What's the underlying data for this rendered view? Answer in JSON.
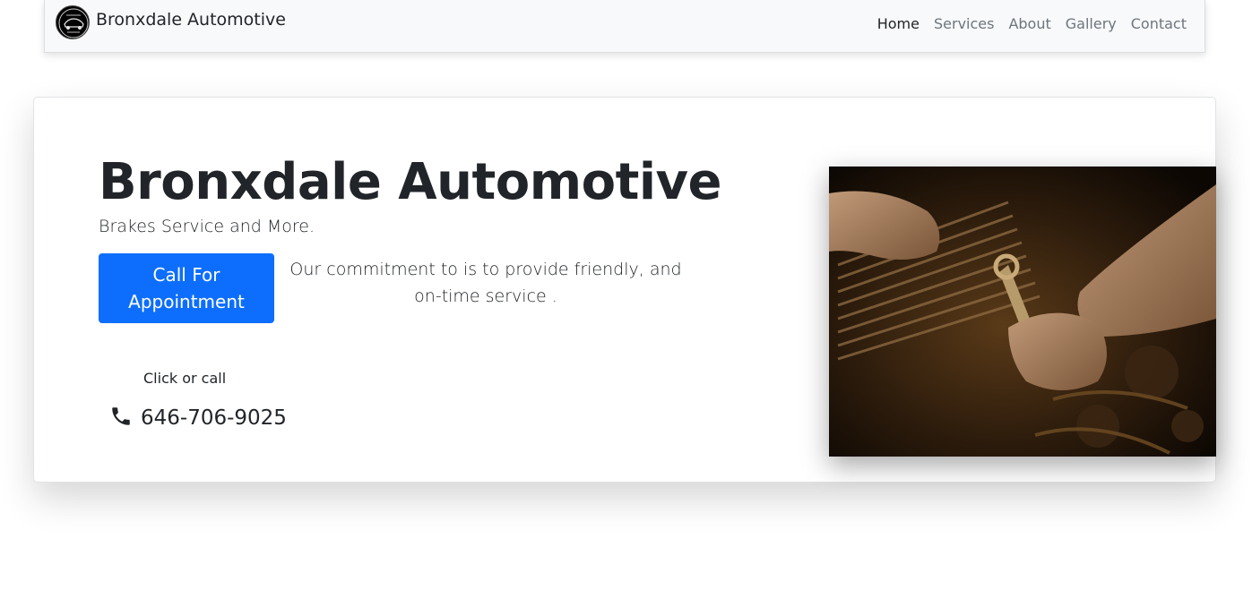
{
  "navbar": {
    "brand": "Bronxdale Automotive",
    "links": [
      "Home",
      "Services",
      "About",
      "Gallery",
      "Contact"
    ]
  },
  "hero": {
    "title": "Bronxdale Automotive",
    "subtitle": "Brakes Service and More.",
    "cta_label": "Call For Appointment",
    "commitment": "Our commitment to is to provide friendly, and on-time service .",
    "click_label": "Click or call",
    "phone": "646-706-9025"
  },
  "colors": {
    "navbar_bg": "#f8f9fa",
    "primary": "#0d6efd",
    "text": "#212529",
    "nav_muted": "#6c757d"
  },
  "icons": [
    "logo-emblem-icon",
    "phone-icon"
  ]
}
